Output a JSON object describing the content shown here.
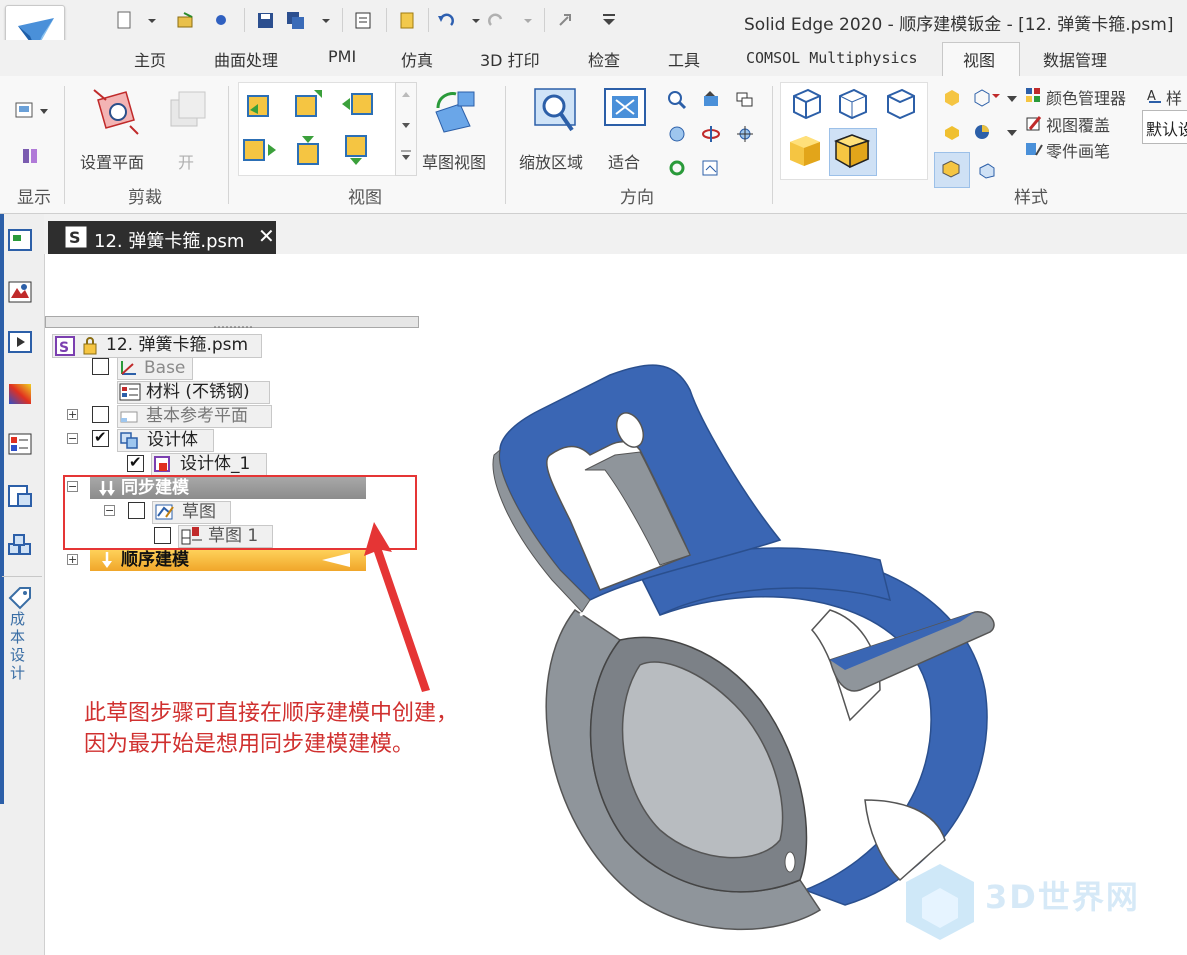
{
  "window": {
    "title": "Solid Edge 2020 - 顺序建模钣金 - [12. 弹簧卡箍.psm]"
  },
  "menu_tabs": [
    "主页",
    "曲面处理",
    "PMI",
    "仿真",
    "3D 打印",
    "检查",
    "工具",
    "COMSOL Multiphysics",
    "视图",
    "数据管理"
  ],
  "active_tab": "视图",
  "ribbon": {
    "groups": {
      "display": "显示",
      "clip": "剪裁",
      "view": "视图",
      "orient": "方向",
      "style": "样式"
    },
    "buttons": {
      "set_plane": "设置平面",
      "open": "开",
      "sketch_view": "草图视图",
      "zoom_area": "缩放区域",
      "fit": "适合",
      "color_manager": "颜色管理器",
      "view_override": "视图覆盖",
      "part_painter": "零件画笔",
      "style_short": "样",
      "default_field": "默认设"
    }
  },
  "document_tab": {
    "label": "12. 弹簧卡箍.psm"
  },
  "tree": {
    "root": "12. 弹簧卡箍.psm",
    "base": "Base",
    "material": "材料 (不锈钢)",
    "ref_planes": "基本参考平面",
    "design_body": "设计体",
    "design_body_1": "设计体_1",
    "sync_modeling": "同步建模",
    "sketch": "草图",
    "sketch_1": "草图 1",
    "ordered_modeling": "顺序建模"
  },
  "left_toolbar": {
    "cost_design": "成本设计"
  },
  "annotation": {
    "line1": "此草图步骤可直接在顺序建模中创建，",
    "line2": "因为最开始是想用同步建模建模。"
  },
  "watermark": {
    "text": "3D世界网"
  },
  "colors": {
    "accent_blue": "#3a66b4",
    "annotation_red": "#e53535",
    "ordered_orange": "#f5b533"
  }
}
